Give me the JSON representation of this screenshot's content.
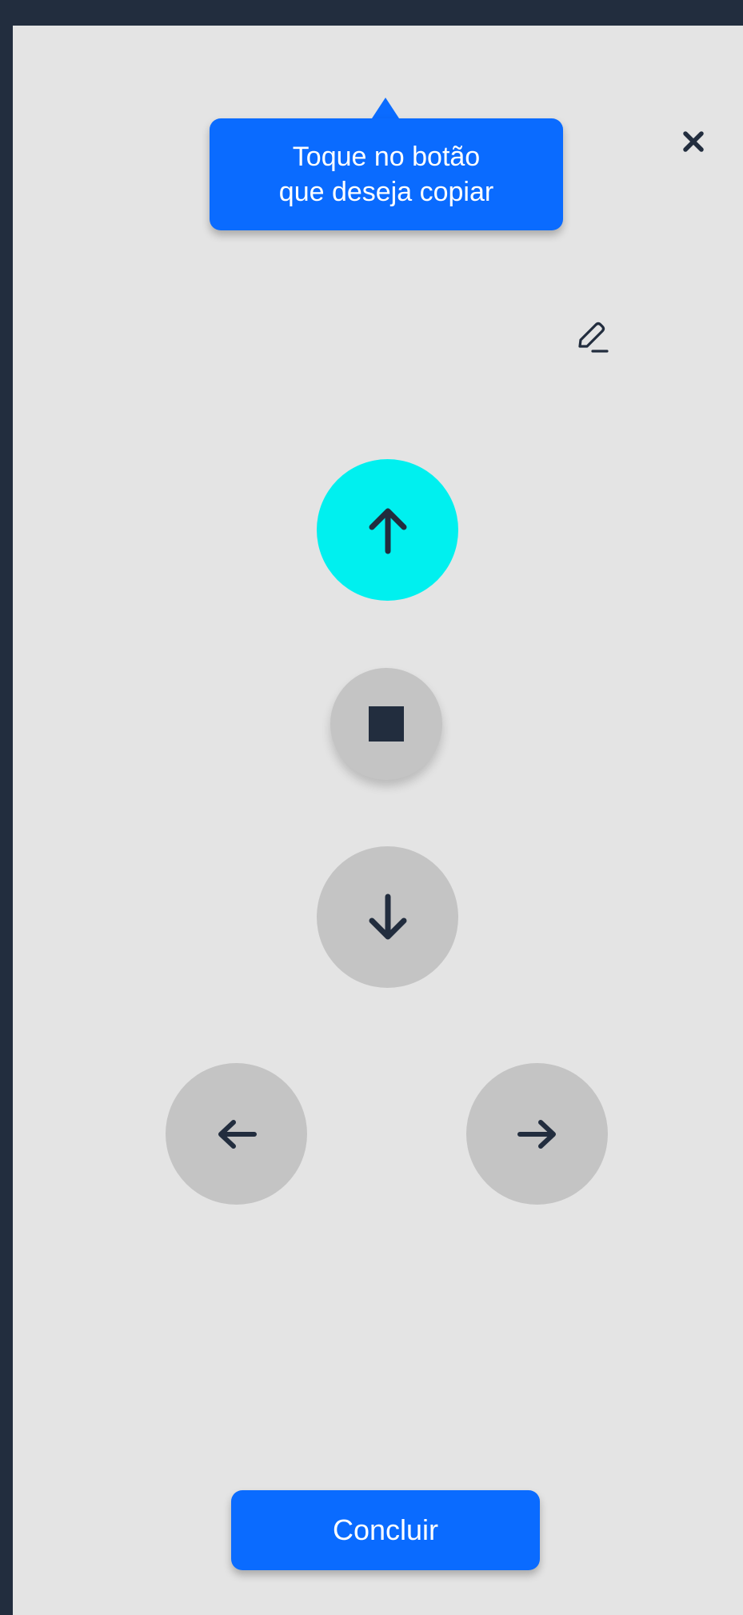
{
  "tooltip": {
    "line1": "Toque no botão",
    "line2": "que deseja copiar"
  },
  "icons": {
    "close": "close-icon",
    "edit": "pencil-icon",
    "up": "arrow-up-icon",
    "stop": "stop-icon",
    "down": "arrow-down-icon",
    "left": "arrow-left-icon",
    "right": "arrow-right-icon"
  },
  "done_label": "Concluir",
  "colors": {
    "background_dark": "#222d3e",
    "panel": "#e4e4e4",
    "accent_blue": "#0a6bff",
    "selected_cyan": "#00f0ef",
    "button_gray": "#c4c4c4",
    "icon_dark": "#222d3e"
  },
  "selected_control": "up"
}
